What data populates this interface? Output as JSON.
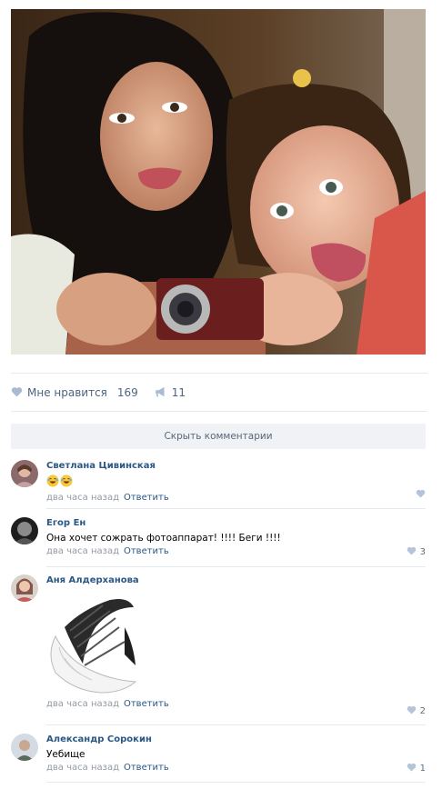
{
  "post": {
    "likes_label": "Мне нравится",
    "likes_count": "169",
    "shares_count": "11"
  },
  "hide_comments_label": "Скрыть комментарии",
  "comments": [
    {
      "author": "Светлана Цивинская",
      "text": "😂😂",
      "time": "два часа назад",
      "reply": "Ответить",
      "likes": ""
    },
    {
      "author": "Егор Ен",
      "text": "Она хочет сожрать фотоаппарат! !!!! Беги !!!!",
      "time": "два часа назад",
      "reply": "Ответить",
      "likes": "3"
    },
    {
      "author": "Аня Алдерханова",
      "text": "",
      "time": "два часа назад",
      "reply": "Ответить",
      "likes": "2"
    },
    {
      "author": "Александр Сорокин",
      "text": "Уебище",
      "time": "два часа назад",
      "reply": "Ответить",
      "likes": "1"
    }
  ],
  "colors": {
    "link": "#2a5885",
    "meta": "#939aa3",
    "bar": "#f0f2f5"
  }
}
